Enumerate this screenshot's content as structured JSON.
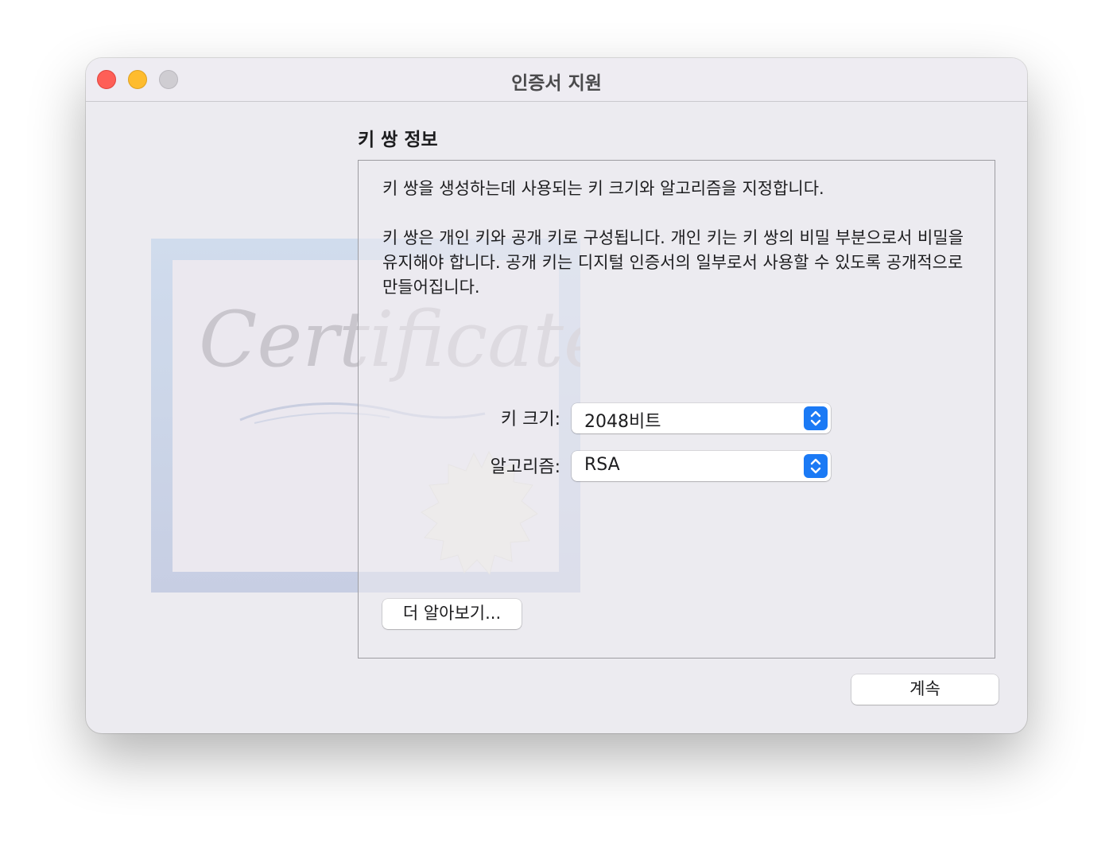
{
  "window": {
    "title": "인증서 지원",
    "traffic_lights": {
      "close": "close-icon",
      "minimize": "minimize-icon",
      "zoom": "zoom-icon"
    }
  },
  "watermark": {
    "text": "Certificate"
  },
  "section": {
    "title": "키 쌍 정보"
  },
  "panel": {
    "description_1": "키 쌍을 생성하는데 사용되는 키 크기와 알고리즘을 지정합니다.",
    "description_2": "키 쌍은 개인 키와 공개 키로 구성됩니다. 개인 키는 키 쌍의 비밀 부분으로서 비밀을 유지해야 합니다. 공개 키는 디지털 인증서의 일부로서 사용할 수 있도록 공개적으로 만들어집니다.",
    "key_size": {
      "label": "키 크기:",
      "value": "2048비트",
      "icon": "chevron-up-down-icon"
    },
    "algorithm": {
      "label": "알고리즘:",
      "value": "RSA",
      "icon": "chevron-up-down-icon"
    },
    "learn_more_label": "더 알아보기..."
  },
  "footer": {
    "continue_label": "계속"
  },
  "colors": {
    "accent": "#1b7af5",
    "close": "#fe5f57",
    "minimize": "#febc2e",
    "zoom_inactive": "#cfcdd2",
    "window_bg": "#ecebf0"
  }
}
